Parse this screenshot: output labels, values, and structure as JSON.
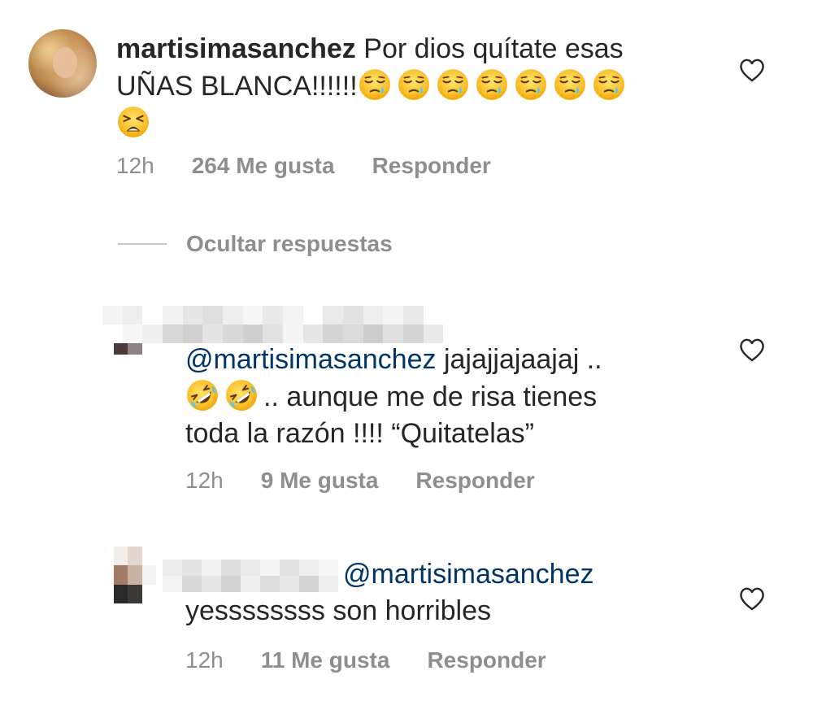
{
  "comments": [
    {
      "username": "martisimasanchez",
      "text_line1": "Por dios quítate esas",
      "text_line2": "UÑAS BLANCA!!!!!!",
      "time": "12h",
      "likes": "264 Me gusta",
      "reply": "Responder"
    }
  ],
  "hide_replies_label": "Ocultar respuestas",
  "replies": [
    {
      "mention": "@martisimasanchez",
      "text_line1": "jajajjajaajaj ..",
      "text_line2": ".. aunque me de risa tienes",
      "text_line3": "toda la razón !!!! “Quitatelas”",
      "time": "12h",
      "likes": "9 Me gusta",
      "reply": "Responder"
    },
    {
      "mention": "@martisimasanchez",
      "text_line1": "yessssssss son horribles",
      "time": "12h",
      "likes": "11 Me gusta",
      "reply": "Responder"
    }
  ],
  "icons": {
    "like": "heart-outline-icon",
    "sleepy_emoji": "sleepy-face-emoji",
    "tired_emoji": "tired-face-emoji",
    "laughing_emoji": "rolling-on-floor-laughing-emoji"
  },
  "colors": {
    "text": "#262626",
    "meta": "#8e8e8e",
    "mention": "#003569"
  }
}
